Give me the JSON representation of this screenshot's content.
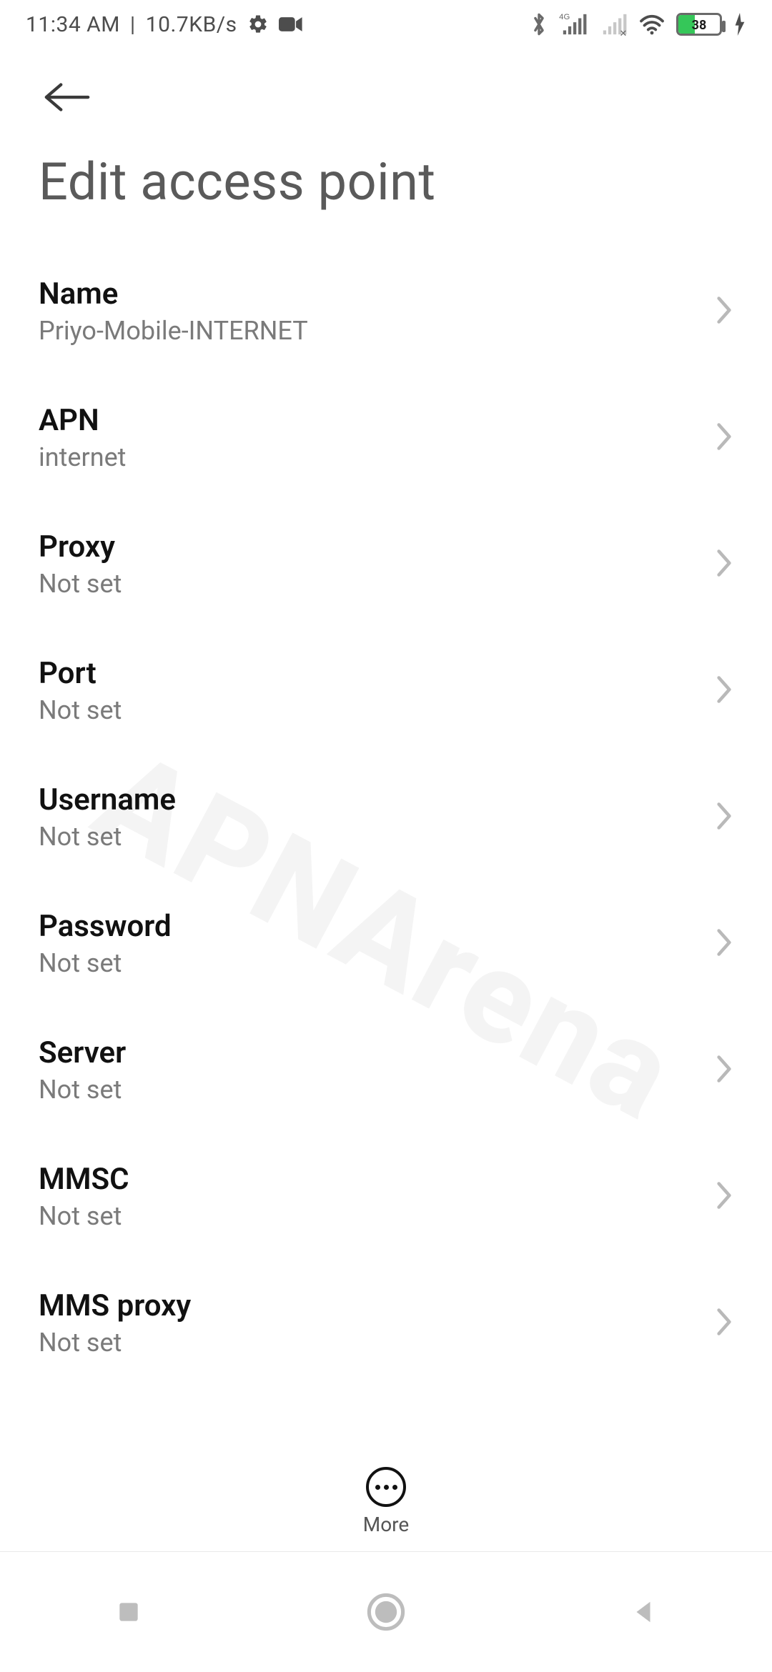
{
  "status": {
    "time": "11:34 AM",
    "separator": "|",
    "net_speed": "10.7KB/s",
    "battery_percent": "38"
  },
  "header": {
    "title": "Edit access point"
  },
  "fields": [
    {
      "label": "Name",
      "value": "Priyo-Mobile-INTERNET"
    },
    {
      "label": "APN",
      "value": "internet"
    },
    {
      "label": "Proxy",
      "value": "Not set"
    },
    {
      "label": "Port",
      "value": "Not set"
    },
    {
      "label": "Username",
      "value": "Not set"
    },
    {
      "label": "Password",
      "value": "Not set"
    },
    {
      "label": "Server",
      "value": "Not set"
    },
    {
      "label": "MMSC",
      "value": "Not set"
    },
    {
      "label": "MMS proxy",
      "value": "Not set"
    }
  ],
  "action_bar": {
    "more_label": "More"
  },
  "watermark": "APNArena"
}
